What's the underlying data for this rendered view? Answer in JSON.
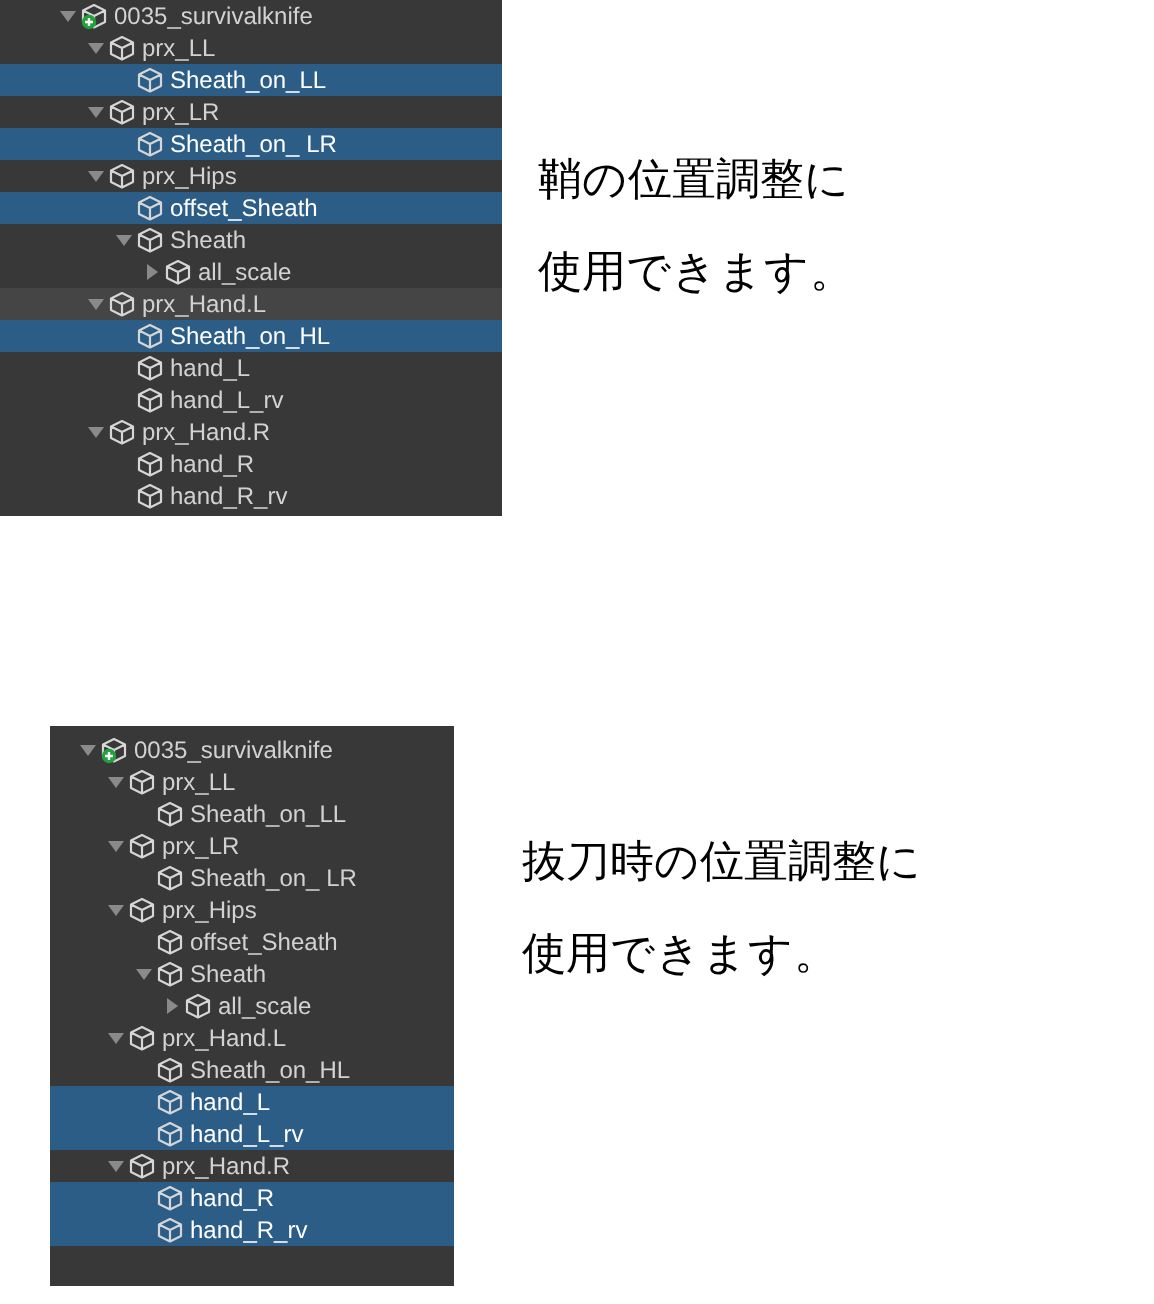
{
  "sections": [
    {
      "hierarchy": [
        {
          "label": "0035_survivalknife",
          "kind": "prefab",
          "expanded": true,
          "selected": false,
          "hovered": false,
          "children": [
            {
              "label": "prx_LL",
              "kind": "object",
              "expanded": true,
              "selected": false,
              "hovered": false,
              "children": [
                {
                  "label": "Sheath_on_LL",
                  "kind": "object",
                  "selected": true,
                  "hovered": false
                }
              ]
            },
            {
              "label": "prx_LR",
              "kind": "object",
              "expanded": true,
              "selected": false,
              "hovered": false,
              "children": [
                {
                  "label": "Sheath_on_ LR",
                  "kind": "object",
                  "selected": true,
                  "hovered": false
                }
              ]
            },
            {
              "label": "prx_Hips",
              "kind": "object",
              "expanded": true,
              "selected": false,
              "hovered": false,
              "children": [
                {
                  "label": "offset_Sheath",
                  "kind": "object",
                  "selected": true,
                  "hovered": false
                },
                {
                  "label": "Sheath",
                  "kind": "object",
                  "expanded": true,
                  "selected": false,
                  "hovered": false,
                  "children": [
                    {
                      "label": "all_scale",
                      "kind": "object",
                      "expanded": false,
                      "selected": false,
                      "hovered": false
                    }
                  ]
                }
              ]
            },
            {
              "label": "prx_Hand.L",
              "kind": "object",
              "expanded": true,
              "selected": false,
              "hovered": true,
              "children": [
                {
                  "label": "Sheath_on_HL",
                  "kind": "object",
                  "selected": true,
                  "hovered": false
                },
                {
                  "label": "hand_L",
                  "kind": "object",
                  "selected": false,
                  "hovered": false
                },
                {
                  "label": "hand_L_rv",
                  "kind": "object",
                  "selected": false,
                  "hovered": false
                }
              ]
            },
            {
              "label": "prx_Hand.R",
              "kind": "object",
              "expanded": true,
              "selected": false,
              "hovered": false,
              "children": [
                {
                  "label": "hand_R",
                  "kind": "object",
                  "selected": false,
                  "hovered": false
                },
                {
                  "label": "hand_R_rv",
                  "kind": "object",
                  "selected": false,
                  "hovered": false
                }
              ]
            }
          ]
        }
      ],
      "caption_lines": [
        "鞘の位置調整に",
        "使用できます。"
      ]
    },
    {
      "hierarchy": [
        {
          "label": "0035_survivalknife",
          "kind": "prefab",
          "expanded": true,
          "selected": false,
          "hovered": false,
          "children": [
            {
              "label": "prx_LL",
              "kind": "object",
              "expanded": true,
              "selected": false,
              "hovered": false,
              "children": [
                {
                  "label": "Sheath_on_LL",
                  "kind": "object",
                  "selected": false,
                  "hovered": false
                }
              ]
            },
            {
              "label": "prx_LR",
              "kind": "object",
              "expanded": true,
              "selected": false,
              "hovered": false,
              "children": [
                {
                  "label": "Sheath_on_ LR",
                  "kind": "object",
                  "selected": false,
                  "hovered": false
                }
              ]
            },
            {
              "label": "prx_Hips",
              "kind": "object",
              "expanded": true,
              "selected": false,
              "hovered": false,
              "children": [
                {
                  "label": "offset_Sheath",
                  "kind": "object",
                  "selected": false,
                  "hovered": false
                },
                {
                  "label": "Sheath",
                  "kind": "object",
                  "expanded": true,
                  "selected": false,
                  "hovered": false,
                  "children": [
                    {
                      "label": "all_scale",
                      "kind": "object",
                      "expanded": false,
                      "selected": false,
                      "hovered": false
                    }
                  ]
                }
              ]
            },
            {
              "label": "prx_Hand.L",
              "kind": "object",
              "expanded": true,
              "selected": false,
              "hovered": false,
              "children": [
                {
                  "label": "Sheath_on_HL",
                  "kind": "object",
                  "selected": false,
                  "hovered": false
                },
                {
                  "label": "hand_L",
                  "kind": "object",
                  "selected": true,
                  "hovered": false
                },
                {
                  "label": "hand_L_rv",
                  "kind": "object",
                  "selected": true,
                  "hovered": false
                }
              ]
            },
            {
              "label": "prx_Hand.R",
              "kind": "object",
              "expanded": true,
              "selected": false,
              "hovered": false,
              "children": [
                {
                  "label": "hand_R",
                  "kind": "object",
                  "selected": true,
                  "hovered": false
                },
                {
                  "label": "hand_R_rv",
                  "kind": "object",
                  "selected": true,
                  "hovered": false
                }
              ]
            }
          ]
        }
      ],
      "caption_lines": [
        "抜刀時の位置調整に",
        "使用できます。"
      ]
    }
  ]
}
